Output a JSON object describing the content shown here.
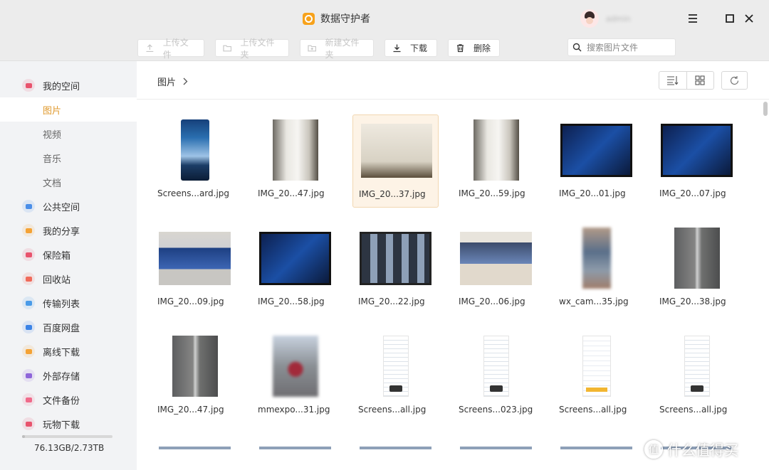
{
  "app": {
    "title": "数据守护者",
    "username": "admin"
  },
  "toolbar": {
    "upload_file": "上传文件",
    "upload_folder": "上传文件夹",
    "new_folder": "新建文件夹",
    "download": "下载",
    "delete": "删除"
  },
  "search": {
    "placeholder": "搜索图片文件"
  },
  "sidebar": {
    "items": [
      {
        "label": "我的空间",
        "icon": "cloud-icon",
        "color": "#e8536d"
      },
      {
        "label": "图片",
        "sub": true,
        "active": true
      },
      {
        "label": "视频",
        "sub": true
      },
      {
        "label": "音乐",
        "sub": true
      },
      {
        "label": "文档",
        "sub": true
      },
      {
        "label": "公共空间",
        "icon": "paper-plane-icon",
        "color": "#4a8ee8"
      },
      {
        "label": "我的分享",
        "icon": "share-icon",
        "color": "#f4a235"
      },
      {
        "label": "保险箱",
        "icon": "safe-icon",
        "color": "#e8536d"
      },
      {
        "label": "回收站",
        "icon": "trash-icon",
        "color": "#f06a5a"
      },
      {
        "label": "传输列表",
        "icon": "transfer-icon",
        "color": "#4a9be8"
      },
      {
        "label": "百度网盘",
        "icon": "baidu-cloud-icon",
        "color": "#3b83e6"
      },
      {
        "label": "离线下载",
        "icon": "download-icon",
        "color": "#f4a235"
      },
      {
        "label": "外部存储",
        "icon": "usb-icon",
        "color": "#8e65d9"
      },
      {
        "label": "文件备份",
        "icon": "backup-icon",
        "color": "#f06a8a"
      },
      {
        "label": "玩物下载",
        "icon": "wanwu-icon",
        "color": "#e8536d"
      }
    ],
    "storage": {
      "text": "76.13GB/2.73TB",
      "used_fraction": 0.03
    }
  },
  "breadcrumb": {
    "label": "图片"
  },
  "files": [
    {
      "name": "Screens...ard.jpg",
      "thumb": "t-phone-blue",
      "selected": false
    },
    {
      "name": "IMG_20...47.jpg",
      "thumb": "t-white-dev",
      "selected": false
    },
    {
      "name": "IMG_20...37.jpg",
      "thumb": "t-box",
      "selected": true
    },
    {
      "name": "IMG_20...59.jpg",
      "thumb": "t-white-dev",
      "selected": false
    },
    {
      "name": "IMG_20...01.jpg",
      "thumb": "t-tv-menu",
      "selected": false
    },
    {
      "name": "IMG_20...07.jpg",
      "thumb": "t-tv-menu",
      "selected": false
    },
    {
      "name": "IMG_20...09.jpg",
      "thumb": "t-tv-room",
      "selected": false
    },
    {
      "name": "IMG_20...58.jpg",
      "thumb": "t-tv-menu",
      "selected": false
    },
    {
      "name": "IMG_20...22.jpg",
      "thumb": "t-tv-grid",
      "selected": false
    },
    {
      "name": "IMG_20...06.jpg",
      "thumb": "t-tv-white",
      "selected": false
    },
    {
      "name": "wx_cam...35.jpg",
      "thumb": "t-blur-tall",
      "selected": false
    },
    {
      "name": "IMG_20...38.jpg",
      "thumb": "t-dark-tall",
      "selected": false
    },
    {
      "name": "IMG_20...47.jpg",
      "thumb": "t-dark-tall",
      "selected": false
    },
    {
      "name": "mmexpo...31.jpg",
      "thumb": "t-blur-photo",
      "selected": false
    },
    {
      "name": "Screens...all.jpg",
      "thumb": "t-screen",
      "selected": false
    },
    {
      "name": "Screens...023.jpg",
      "thumb": "t-screen",
      "selected": false
    },
    {
      "name": "Screens...all.jpg",
      "thumb": "t-screen-w",
      "selected": false
    },
    {
      "name": "Screens...all.jpg",
      "thumb": "t-screen",
      "selected": false
    }
  ],
  "watermark": {
    "text": "什么值得买",
    "icon": "值"
  }
}
